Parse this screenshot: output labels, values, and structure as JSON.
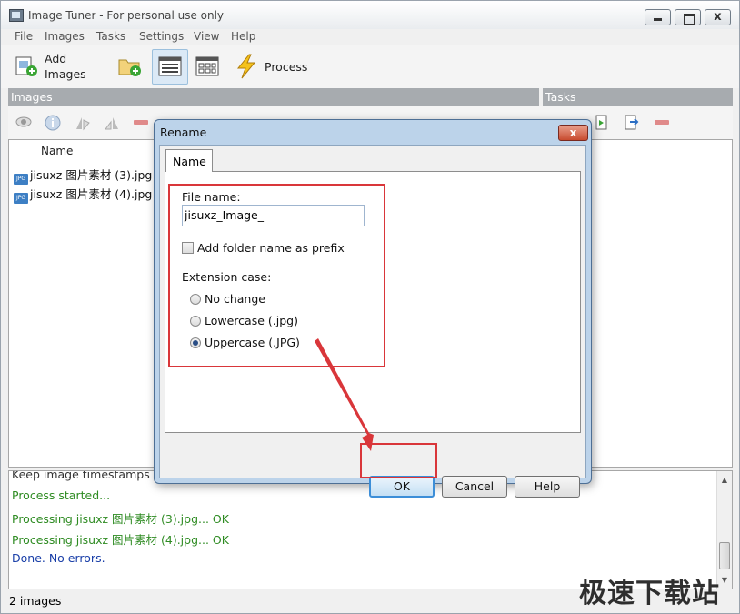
{
  "window": {
    "title": "Image Tuner - For personal use only",
    "close_glyph": "x"
  },
  "menu": [
    "File",
    "Images",
    "Tasks",
    "Settings",
    "View",
    "Help"
  ],
  "toolbar": {
    "add_images_line1": "Add",
    "add_images_line2": "Images",
    "process_label": "Process"
  },
  "panes": {
    "images_header": "Images",
    "tasks_header": "Tasks"
  },
  "image_list": {
    "column_name": "Name",
    "badge": "JPG",
    "rows": [
      "jisuxz 图片素材 (3).jpg",
      "jisuxz 图片素材 (4).jpg"
    ]
  },
  "log": {
    "lines": [
      {
        "text": "Keep image timestamps",
        "color": "#333333"
      },
      {
        "text": "Process started...",
        "color": "#2e8b22"
      },
      {
        "text": "Processing jisuxz 图片素材 (3).jpg... OK",
        "color": "#2e8b22"
      },
      {
        "text": "Processing jisuxz 图片素材 (4).jpg... OK",
        "color": "#2e8b22"
      },
      {
        "text": "Done. No errors.",
        "color": "#1a3fa8"
      }
    ]
  },
  "status": {
    "count": "2 images"
  },
  "watermark": "极速下载站",
  "dialog": {
    "title": "Rename",
    "close_glyph": "x",
    "tab": "Name",
    "file_name_label": "File name:",
    "file_name_value": "jisuxz_Image_",
    "prefix_label": "Add folder name as prefix",
    "prefix_checked": false,
    "extension_case_label": "Extension case:",
    "options": [
      {
        "label": "No change",
        "selected": false
      },
      {
        "label": "Lowercase (.jpg)",
        "selected": false
      },
      {
        "label": "Uppercase (.JPG)",
        "selected": true
      }
    ],
    "ok_label": "OK",
    "cancel_label": "Cancel",
    "help_label": "Help"
  },
  "colors": {
    "annotation_red": "#d9363a",
    "pane_header": "#a7abaf",
    "dialog_frame": "#bcd3ea"
  }
}
